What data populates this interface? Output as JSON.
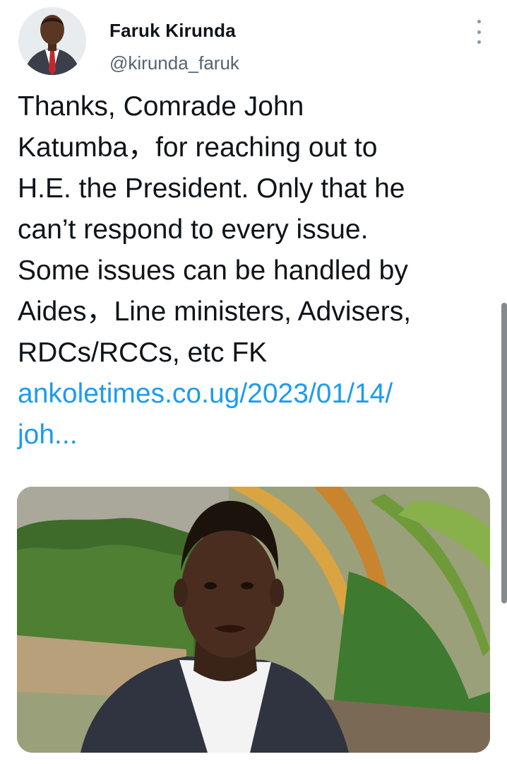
{
  "author": {
    "display_name": "Faruk Kirunda",
    "handle": "@kirunda_faruk"
  },
  "tweet": {
    "lines": [
      "Thanks, Comrade John",
      "Katumba，for reaching out to",
      "H.E. the President. Only that he",
      "can’t respond to every issue.",
      "Some issues can be handled by",
      "Aides，Line ministers, Advisers,",
      "RDCs/RCCs, etc FK"
    ],
    "link_line_1": "ankoletimes.co.ug/2023/01/14/",
    "link_line_2": "joh..."
  },
  "icons": {
    "more": "more-vertical-icon"
  },
  "colors": {
    "text": "#0f1419",
    "secondary": "#536471",
    "link": "#1d9bf0"
  }
}
